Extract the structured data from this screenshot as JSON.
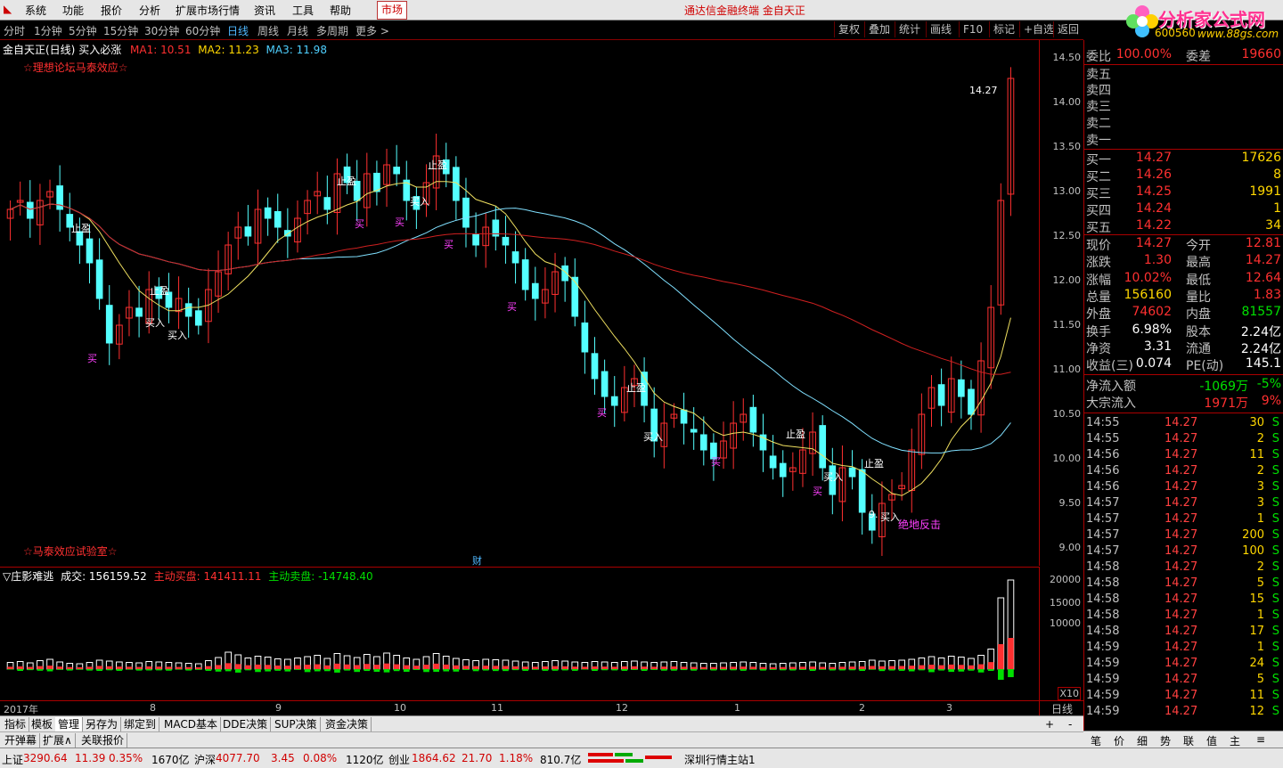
{
  "menu": [
    "系统",
    "功能",
    "报价",
    "分析",
    "扩展市场行情",
    "资讯",
    "工具",
    "帮助"
  ],
  "market_btn": "市场",
  "center_title": "通达信金融终端  金自天正",
  "logo": {
    "title": "分析家公式网",
    "url": "www.88gs.com",
    "code": "600560"
  },
  "periods": [
    "分时",
    "1分钟",
    "5分钟",
    "15分钟",
    "30分钟",
    "60分钟",
    "日线",
    "周线",
    "月线",
    "多周期",
    "更多 >"
  ],
  "active_period": "日线",
  "toolbar_right": [
    "复权",
    "叠加",
    "统计",
    "画线",
    "F10",
    "标记",
    "+自选",
    "返回"
  ],
  "chart_header": {
    "name": "金自天正(日线)",
    "indicator": "买入必涨",
    "ma1": "MA1: 10.51",
    "ma2": "MA2: 11.23",
    "ma3": "MA3: 11.98",
    "note_top": "☆理想论坛马泰效应☆",
    "note_bottom": "☆马泰效应试验室☆",
    "cai": "财"
  },
  "vol_header": {
    "name": "▽庄影难逃",
    "volume": "成交: 156159.52",
    "buy": "主动买盘: 141411.11",
    "sell": "主动卖盘: -14748.40"
  },
  "price_ticks": [
    "14.50",
    "14.00",
    "13.50",
    "13.00",
    "12.50",
    "12.00",
    "11.50",
    "11.00",
    "10.50",
    "10.00",
    "9.50",
    "9.00"
  ],
  "vol_ticks": [
    "20000",
    "15000",
    "10000"
  ],
  "vol_unit": "X10",
  "date_ticks": [
    "2017年",
    "8",
    "9",
    "10",
    "11",
    "12",
    "1",
    "2",
    "3"
  ],
  "date_axis_label": "日线",
  "annotations": {
    "high_label": "14.27",
    "low_label": "9.",
    "signal": "绝地反击",
    "take_profit": "止盈",
    "buy_in": "买入",
    "buy": "买"
  },
  "bottom_tabs": [
    "指标",
    "模板",
    "管理",
    "另存为",
    "绑定到",
    "MACD基本",
    "DDE决策",
    "SUP决策",
    "资金决策"
  ],
  "bottom_tabs2": [
    "开弹幕",
    "扩展∧",
    "关联报价"
  ],
  "status": [
    {
      "label": "上证",
      "price": "3290.64",
      "chg": "11.39",
      "pct": "0.35%",
      "amt": "1670亿"
    },
    {
      "label": "沪深",
      "price": "4077.70",
      "chg": "3.45",
      "pct": "0.08%",
      "amt": "1120亿"
    },
    {
      "label": "创业",
      "price": "1864.62",
      "chg": "21.70",
      "pct": "1.18%",
      "amt": "810.7亿"
    }
  ],
  "status_station": "深圳行情主站1",
  "quote": {
    "weibi": {
      "k": "委比",
      "v": "100.00%",
      "k2": "委差",
      "v2": "19660"
    },
    "sells": [
      "卖五",
      "卖四",
      "卖三",
      "卖二",
      "卖一"
    ],
    "buys": [
      {
        "k": "买一",
        "p": "14.27",
        "q": "17626"
      },
      {
        "k": "买二",
        "p": "14.26",
        "q": "8"
      },
      {
        "k": "买三",
        "p": "14.25",
        "q": "1991"
      },
      {
        "k": "买四",
        "p": "14.24",
        "q": "1"
      },
      {
        "k": "买五",
        "p": "14.22",
        "q": "34"
      }
    ],
    "stats": [
      {
        "k": "现价",
        "v": "14.27",
        "k2": "今开",
        "v2": "12.81",
        "c1": "red",
        "c2": "red"
      },
      {
        "k": "涨跌",
        "v": "1.30",
        "k2": "最高",
        "v2": "14.27",
        "c1": "red",
        "c2": "red"
      },
      {
        "k": "涨幅",
        "v": "10.02%",
        "k2": "最低",
        "v2": "12.64",
        "c1": "red",
        "c2": "red"
      },
      {
        "k": "总量",
        "v": "156160",
        "k2": "量比",
        "v2": "1.83",
        "c1": "yellow",
        "c2": "red"
      },
      {
        "k": "外盘",
        "v": "74602",
        "k2": "内盘",
        "v2": "81557",
        "c1": "red",
        "c2": "green"
      },
      {
        "k": "换手",
        "v": "6.98%",
        "k2": "股本",
        "v2": "2.24亿",
        "c1": "white",
        "c2": "white"
      },
      {
        "k": "净资",
        "v": "3.31",
        "k2": "流通",
        "v2": "2.24亿",
        "c1": "white",
        "c2": "white"
      },
      {
        "k": "收益(三)",
        "v": "0.074",
        "k2": "PE(动)",
        "v2": "145.1",
        "c1": "white",
        "c2": "white"
      }
    ],
    "flow": [
      {
        "k": "净流入额",
        "v": "-1069万",
        "v2": "-5%",
        "c": "green"
      },
      {
        "k": "大宗流入",
        "v": "1971万",
        "v2": "9%",
        "c": "red"
      }
    ],
    "ticks": [
      {
        "t": "14:55",
        "p": "14.27",
        "q": "30",
        "s": "S"
      },
      {
        "t": "14:55",
        "p": "14.27",
        "q": "2",
        "s": "S"
      },
      {
        "t": "14:56",
        "p": "14.27",
        "q": "11",
        "s": "S"
      },
      {
        "t": "14:56",
        "p": "14.27",
        "q": "2",
        "s": "S"
      },
      {
        "t": "14:56",
        "p": "14.27",
        "q": "3",
        "s": "S"
      },
      {
        "t": "14:57",
        "p": "14.27",
        "q": "3",
        "s": "S"
      },
      {
        "t": "14:57",
        "p": "14.27",
        "q": "1",
        "s": "S"
      },
      {
        "t": "14:57",
        "p": "14.27",
        "q": "200",
        "s": "S"
      },
      {
        "t": "14:57",
        "p": "14.27",
        "q": "100",
        "s": "S"
      },
      {
        "t": "14:58",
        "p": "14.27",
        "q": "2",
        "s": "S"
      },
      {
        "t": "14:58",
        "p": "14.27",
        "q": "5",
        "s": "S"
      },
      {
        "t": "14:58",
        "p": "14.27",
        "q": "15",
        "s": "S"
      },
      {
        "t": "14:58",
        "p": "14.27",
        "q": "1",
        "s": "S"
      },
      {
        "t": "14:58",
        "p": "14.27",
        "q": "17",
        "s": "S"
      },
      {
        "t": "14:59",
        "p": "14.27",
        "q": "1",
        "s": "S"
      },
      {
        "t": "14:59",
        "p": "14.27",
        "q": "24",
        "s": "S"
      },
      {
        "t": "14:59",
        "p": "14.27",
        "q": "5",
        "s": "S"
      },
      {
        "t": "14:59",
        "p": "14.27",
        "q": "11",
        "s": "S"
      },
      {
        "t": "14:59",
        "p": "14.27",
        "q": "12",
        "s": "S"
      }
    ]
  },
  "right_tabs": [
    "笔",
    "价",
    "细",
    "势",
    "联",
    "值",
    "主",
    "≡"
  ],
  "colors": {
    "up": "#ff3030",
    "down": "#54ffff",
    "ma1": "#ffffff",
    "ma2": "#f0e060",
    "ma3": "#ff40ff",
    "ma_long1": "#80e0ff",
    "ma_long2": "#d02020"
  },
  "chart_data": {
    "type": "candlestick",
    "price_range": [
      8.8,
      14.7
    ],
    "last_close": 14.27,
    "closes": [
      12.8,
      12.9,
      12.7,
      12.9,
      13.0,
      12.8,
      12.6,
      12.4,
      12.2,
      11.8,
      11.3,
      11.5,
      11.7,
      11.6,
      11.9,
      11.8,
      11.7,
      11.8,
      11.6,
      11.5,
      11.9,
      12.1,
      12.4,
      12.6,
      12.5,
      12.8,
      12.7,
      12.6,
      12.5,
      12.7,
      12.9,
      13.0,
      12.8,
      13.2,
      13.1,
      12.9,
      13.2,
      13.0,
      13.3,
      13.2,
      12.9,
      12.8,
      13.1,
      13.4,
      13.2,
      12.9,
      12.6,
      12.4,
      12.6,
      12.5,
      12.4,
      12.2,
      11.9,
      11.8,
      11.9,
      12.1,
      12.0,
      11.6,
      11.2,
      10.9,
      10.7,
      10.6,
      10.8,
      10.9,
      10.6,
      10.2,
      10.4,
      10.5,
      10.4,
      10.3,
      10.1,
      10.0,
      10.2,
      10.4,
      10.5,
      10.3,
      10.1,
      9.9,
      9.8,
      9.9,
      10.1,
      10.3,
      9.9,
      9.6,
      9.9,
      9.8,
      9.4,
      9.2,
      9.5,
      9.6,
      9.7,
      10.1,
      10.5,
      10.8,
      10.6,
      10.9,
      10.7,
      10.5,
      11.1,
      11.7,
      12.9,
      14.27
    ],
    "volumes": [
      1500,
      1700,
      1400,
      1900,
      2200,
      1600,
      1300,
      1200,
      1500,
      2000,
      1800,
      1600,
      1500,
      1400,
      1700,
      1600,
      1500,
      1400,
      1300,
      1200,
      1900,
      2600,
      3800,
      3200,
      2500,
      2900,
      2700,
      2300,
      2200,
      2500,
      2800,
      3100,
      2400,
      3500,
      3000,
      2600,
      3300,
      2800,
      3600,
      3100,
      2500,
      2200,
      2800,
      3500,
      2900,
      2400,
      2100,
      1900,
      2200,
      2100,
      2000,
      1800,
      1600,
      1500,
      1700,
      1900,
      1800,
      1600,
      1500,
      1700,
      1600,
      1500,
      1700,
      1800,
      1600,
      1500,
      1600,
      1700,
      1500,
      1400,
      1300,
      1300,
      1400,
      1500,
      1600,
      1500,
      1300,
      1200,
      1300,
      1400,
      1500,
      1600,
      1400,
      1300,
      1500,
      1600,
      1700,
      2000,
      1800,
      1900,
      2000,
      2200,
      2500,
      2800,
      2500,
      2900,
      2700,
      2400,
      3100,
      4500,
      16000,
      20000
    ]
  }
}
